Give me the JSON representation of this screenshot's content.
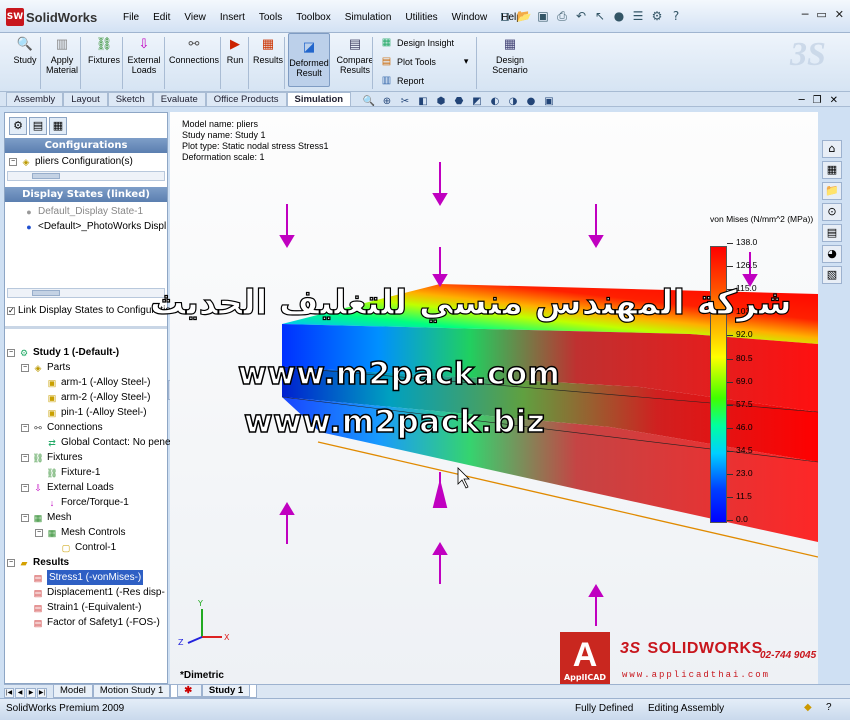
{
  "app": {
    "logo_text": "SolidWorks",
    "logo_badge": "SW"
  },
  "menu": [
    "File",
    "Edit",
    "View",
    "Insert",
    "Tools",
    "Toolbox",
    "Simulation",
    "Utilities",
    "Window",
    "Help"
  ],
  "ribbon": {
    "buttons": [
      {
        "label": "Study",
        "icon": "magnifier-icon"
      },
      {
        "label": "Apply Material",
        "icon": "material-icon"
      },
      {
        "label": "Fixtures",
        "icon": "fixture-icon"
      },
      {
        "label": "External Loads",
        "icon": "load-arrow-icon"
      },
      {
        "label": "Connections",
        "icon": "connection-icon"
      },
      {
        "label": "Run",
        "icon": "run-icon"
      },
      {
        "label": "Results",
        "icon": "results-icon"
      },
      {
        "label": "Deformed Result",
        "icon": "deformed-icon"
      },
      {
        "label": "Compare Results",
        "icon": "compare-icon"
      },
      {
        "label": "Design Scenario",
        "icon": "scenario-icon"
      }
    ],
    "small": [
      "Design Insight",
      "Plot Tools",
      "Report"
    ]
  },
  "tabs": [
    "Assembly",
    "Layout",
    "Sketch",
    "Evaluate",
    "Office Products",
    "Simulation"
  ],
  "active_tab": "Simulation",
  "left_panel": {
    "configurations_title": "Configurations",
    "config_item": "pliers Configuration(s)",
    "display_states_title": "Display States (linked)",
    "display_states": [
      "Default_Display State-1",
      "<Default>_PhotoWorks Displ"
    ],
    "link_checkbox": "Link Display States to Configurations",
    "tree": [
      {
        "level": 0,
        "label": "Study 1 (-Default-)",
        "icon": "study-icon",
        "bold": true
      },
      {
        "level": 1,
        "label": "Parts",
        "icon": "parts-icon"
      },
      {
        "level": 2,
        "label": "arm-1 (-Alloy Steel-)",
        "icon": "part-icon"
      },
      {
        "level": 2,
        "label": "arm-2 (-Alloy Steel-)",
        "icon": "part-icon"
      },
      {
        "level": 2,
        "label": "pin-1 (-Alloy Steel-)",
        "icon": "part-icon"
      },
      {
        "level": 1,
        "label": "Connections",
        "icon": "connection-icon"
      },
      {
        "level": 2,
        "label": "Global Contact: No penet",
        "icon": "contact-icon"
      },
      {
        "level": 1,
        "label": "Fixtures",
        "icon": "fixture-icon"
      },
      {
        "level": 2,
        "label": "Fixture-1",
        "icon": "fixture-icon"
      },
      {
        "level": 1,
        "label": "External Loads",
        "icon": "load-arrow-icon"
      },
      {
        "level": 2,
        "label": "Force/Torque-1",
        "icon": "force-icon"
      },
      {
        "level": 1,
        "label": "Mesh",
        "icon": "mesh-icon"
      },
      {
        "level": 2,
        "label": "Mesh Controls",
        "icon": "mesh-icon"
      },
      {
        "level": 3,
        "label": "Control-1",
        "icon": "control-icon"
      },
      {
        "level": 0,
        "label": "Results",
        "icon": "folder-icon",
        "bold": true
      },
      {
        "level": 1,
        "label": "Stress1 (-vonMises-)",
        "icon": "plot-icon",
        "selected": true
      },
      {
        "level": 1,
        "label": "Displacement1 (-Res disp-",
        "icon": "plot-icon"
      },
      {
        "level": 1,
        "label": "Strain1 (-Equivalent-)",
        "icon": "plot-icon"
      },
      {
        "level": 1,
        "label": "Factor of Safety1 (-FOS-)",
        "icon": "plot-icon"
      }
    ]
  },
  "plot_info": [
    "Model name: pliers",
    "Study name: Study 1",
    "Plot type: Static nodal stress Stress1",
    "Deformation scale: 1"
  ],
  "legend": {
    "title": "von Mises (N/mm^2 (MPa))",
    "ticks": [
      "138.0",
      "126.5",
      "115.0",
      "103.5",
      "92.0",
      "80.5",
      "69.0",
      "57.5",
      "46.0",
      "34.5",
      "23.0",
      "11.5",
      "0.0"
    ]
  },
  "view_label": "*Dimetric",
  "watermarks": {
    "arabic": "شركة المهندس منسي للتغليف الحديث",
    "url1": "www.m2pack.com",
    "url2": "www.m2pack.biz"
  },
  "branding": {
    "applicad": "ApplICAD",
    "applicad_letter": "A",
    "solidworks": "SOLIDWORKS",
    "ds_prefix": "3S",
    "phone": "02-744 9045",
    "website": "www.applicadthai.com"
  },
  "bottom_tabs": [
    "Model",
    "Motion Study 1",
    "Study 1"
  ],
  "status": {
    "product": "SolidWorks Premium 2009",
    "state": "Fully Defined",
    "mode": "Editing Assembly"
  },
  "colors": {
    "red": "#ff0000",
    "accent": "#c8161d",
    "arrow": "#c000c0"
  }
}
